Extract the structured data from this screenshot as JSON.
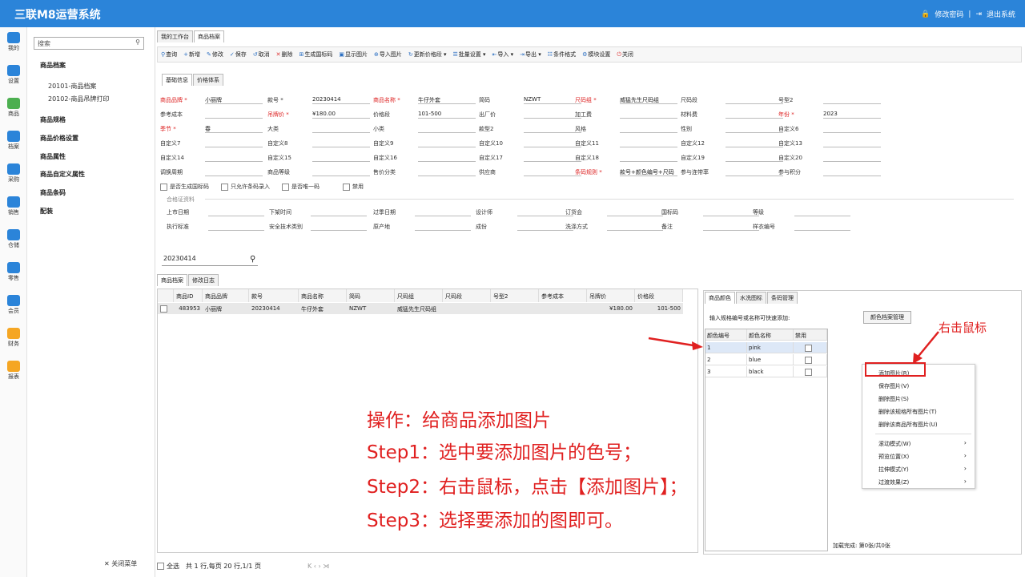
{
  "app": {
    "title": "三联M8运营系统",
    "change_password": "修改密码",
    "logout": "退出系统"
  },
  "leftnav": [
    "我的",
    "设置",
    "商品",
    "档案",
    "采购",
    "销售",
    "仓储",
    "零售",
    "会员",
    "财务",
    "报表"
  ],
  "sidemenu": {
    "search_placeholder": "搜索",
    "header": "商品档案",
    "subitems": [
      "20101-商品档案",
      "20102-商品吊牌打印"
    ],
    "groups": [
      "商品规格",
      "商品价格设置",
      "商品属性",
      "商品自定义属性",
      "商品条码",
      "配装"
    ],
    "close_menu": "关闭菜单"
  },
  "tabs": [
    "我的工作台",
    "商品档案"
  ],
  "toolbar": [
    "查询",
    "新增",
    "修改",
    "保存",
    "取消",
    "删除",
    "生成国标码",
    "显示图片",
    "导入图片",
    "更新价格段 ▾",
    "批量设置 ▾",
    "导入 ▾",
    "导出 ▾",
    "条件格式",
    "模块设置",
    "关闭"
  ],
  "subtabs": [
    "基础信息",
    "价格体系"
  ],
  "form": {
    "row1": [
      {
        "label": "商品品牌 *",
        "req": true,
        "value": "小丽牌"
      },
      {
        "label": "款号 *",
        "value": "20230414"
      },
      {
        "label": "商品名称 *",
        "req": true,
        "value": "牛仔外套"
      },
      {
        "label": "简码",
        "value": "NZWT"
      },
      {
        "label": "尺码组 *",
        "req": true,
        "value": "威猛先生尺码组"
      },
      {
        "label": "尺码段",
        "value": ""
      },
      {
        "label": "号型2",
        "value": ""
      }
    ],
    "row2": [
      {
        "label": "参考成本",
        "value": ""
      },
      {
        "label": "吊牌价 *",
        "req": true,
        "value": "¥180.00"
      },
      {
        "label": "价格段",
        "value": "101-500"
      },
      {
        "label": "出厂价",
        "value": ""
      },
      {
        "label": "加工费",
        "value": ""
      },
      {
        "label": "材料费",
        "value": ""
      },
      {
        "label": "年份 *",
        "req": true,
        "value": "2023"
      }
    ],
    "row3": [
      {
        "label": "季节 *",
        "req": true,
        "value": "春"
      },
      {
        "label": "大类",
        "value": ""
      },
      {
        "label": "小类",
        "value": ""
      },
      {
        "label": "款型2",
        "value": ""
      },
      {
        "label": "风格",
        "value": ""
      },
      {
        "label": "性别",
        "value": ""
      },
      {
        "label": "自定义6",
        "value": ""
      }
    ],
    "row4": [
      {
        "label": "自定义7",
        "value": ""
      },
      {
        "label": "自定义8",
        "value": ""
      },
      {
        "label": "自定义9",
        "value": ""
      },
      {
        "label": "自定义10",
        "value": ""
      },
      {
        "label": "自定义11",
        "value": ""
      },
      {
        "label": "自定义12",
        "value": ""
      },
      {
        "label": "自定义13",
        "value": ""
      }
    ],
    "row5": [
      {
        "label": "自定义14",
        "value": ""
      },
      {
        "label": "自定义15",
        "value": ""
      },
      {
        "label": "自定义16",
        "value": ""
      },
      {
        "label": "自定义17",
        "value": ""
      },
      {
        "label": "自定义18",
        "value": ""
      },
      {
        "label": "自定义19",
        "value": ""
      },
      {
        "label": "自定义20",
        "value": ""
      }
    ],
    "row6": [
      {
        "label": "调换周期",
        "value": ""
      },
      {
        "label": "商品等级",
        "value": ""
      },
      {
        "label": "售价分类",
        "value": ""
      },
      {
        "label": "供应商",
        "value": ""
      },
      {
        "label": "条码规则 *",
        "req": true,
        "value": "款号+颜色编号+尺码"
      },
      {
        "label": "参与连带率",
        "value": ""
      },
      {
        "label": "参与积分",
        "value": ""
      }
    ],
    "checks": [
      "是否生成国标码",
      "只允许条码录入",
      "是否唯一码",
      "禁用"
    ],
    "cert_title": "合格证资料",
    "cert1": [
      "上市日期",
      "下架时间",
      "过季日期",
      "设计师",
      "订货会",
      "国标码",
      "等级"
    ],
    "cert2": [
      "执行标准",
      "安全技术类别",
      "原产地",
      "成份",
      "洗涤方式",
      "备注",
      "样衣编号"
    ]
  },
  "code_search": "20230414",
  "bottom_tabs": [
    "商品档案",
    "修改日志"
  ],
  "grid": {
    "headers": [
      "商品ID",
      "商品品牌",
      "款号",
      "商品名称",
      "简码",
      "尺码组",
      "尺码段",
      "号型2",
      "参考成本",
      "吊牌价",
      "价格段"
    ],
    "row": [
      "483953",
      "小丽牌",
      "20230414",
      "牛仔外套",
      "NZWT",
      "威猛先生尺码组",
      "",
      "",
      "",
      "¥180.00",
      "101-500"
    ]
  },
  "right_tabs": [
    "商品颜色",
    "水洗图标",
    "条码管理"
  ],
  "color_hint": "输入规格编号或名称可快速添加:",
  "color_mgmt": "颜色档案管理",
  "color_table": {
    "headers": [
      "颜色编号",
      "颜色名称",
      "禁用"
    ],
    "rows": [
      [
        "1",
        "pink"
      ],
      [
        "2",
        "blue"
      ],
      [
        "3",
        "black"
      ]
    ]
  },
  "context_menu": [
    "添加图片(R)",
    "保存图片(V)",
    "删除图片(S)",
    "删除该规格所有图片(T)",
    "删除该商品所有图片(U)",
    "滚动模式(W)",
    "预览位置(X)",
    "拉伸模式(Y)",
    "过渡效果(Z)"
  ],
  "load_status": "加载完成: 第0张/共0张",
  "right_click_label": "右击鼠标",
  "annotations": [
    "操作：给商品添加图片",
    "Step1：选中要添加图片的色号；",
    "Step2：右击鼠标，点击【添加图片】；",
    "Step3：选择要添加的图即可。"
  ],
  "footer": {
    "select_all": "全选",
    "summary": "共 1 行,每页 20 行,1/1 页",
    "pager": "K ‹ › ⋊"
  },
  "colors": {
    "topbar": "#2b84d9",
    "annotation": "#e02020"
  }
}
